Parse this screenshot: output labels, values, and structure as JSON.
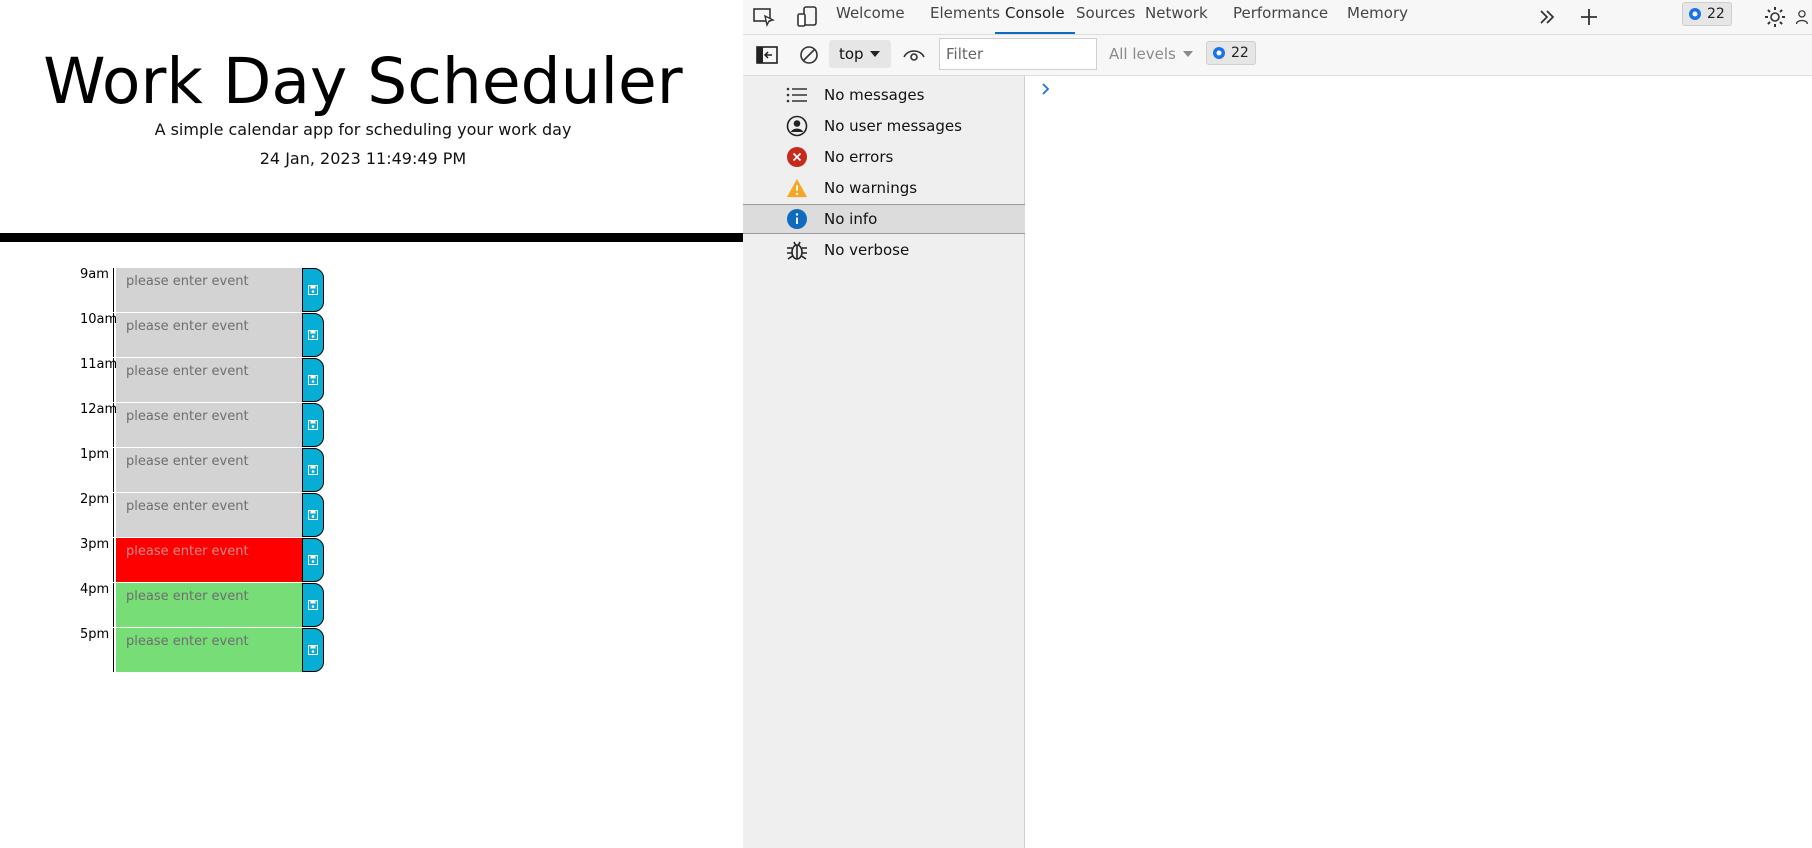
{
  "page": {
    "title": "Work Day Scheduler",
    "lead": "A simple calendar app for scheduling your work day",
    "datetime": "24 Jan, 2023 11:49:49 PM",
    "placeholder": "please enter event",
    "rows": [
      {
        "hour": "9am",
        "state": "past"
      },
      {
        "hour": "10am",
        "state": "past"
      },
      {
        "hour": "11am",
        "state": "past"
      },
      {
        "hour": "12am",
        "state": "past"
      },
      {
        "hour": "1pm",
        "state": "past"
      },
      {
        "hour": "2pm",
        "state": "past"
      },
      {
        "hour": "3pm",
        "state": "present"
      },
      {
        "hour": "4pm",
        "state": "future"
      },
      {
        "hour": "5pm",
        "state": "future"
      }
    ],
    "colors": {
      "past": "#d3d3d3",
      "present": "#ff0000",
      "future": "#77dd77",
      "save": "#06aed5"
    }
  },
  "devtools": {
    "tabs": [
      {
        "label": "Welcome",
        "active": false
      },
      {
        "label": "Elements",
        "active": false
      },
      {
        "label": "Console",
        "active": true
      },
      {
        "label": "Sources",
        "active": false
      },
      {
        "label": "Network",
        "active": false
      },
      {
        "label": "Performance",
        "active": false
      },
      {
        "label": "Memory",
        "active": false
      }
    ],
    "issues_count": "22",
    "context": "top",
    "filter_placeholder": "Filter",
    "levels_label": "All levels",
    "sidebar": [
      {
        "label": "No messages",
        "icon": "list-icon"
      },
      {
        "label": "No user messages",
        "icon": "user-icon"
      },
      {
        "label": "No errors",
        "icon": "error-icon"
      },
      {
        "label": "No warnings",
        "icon": "warning-icon"
      },
      {
        "label": "No info",
        "icon": "info-icon",
        "selected": true
      },
      {
        "label": "No verbose",
        "icon": "bug-icon"
      }
    ],
    "accent": "#0f6cbd"
  }
}
